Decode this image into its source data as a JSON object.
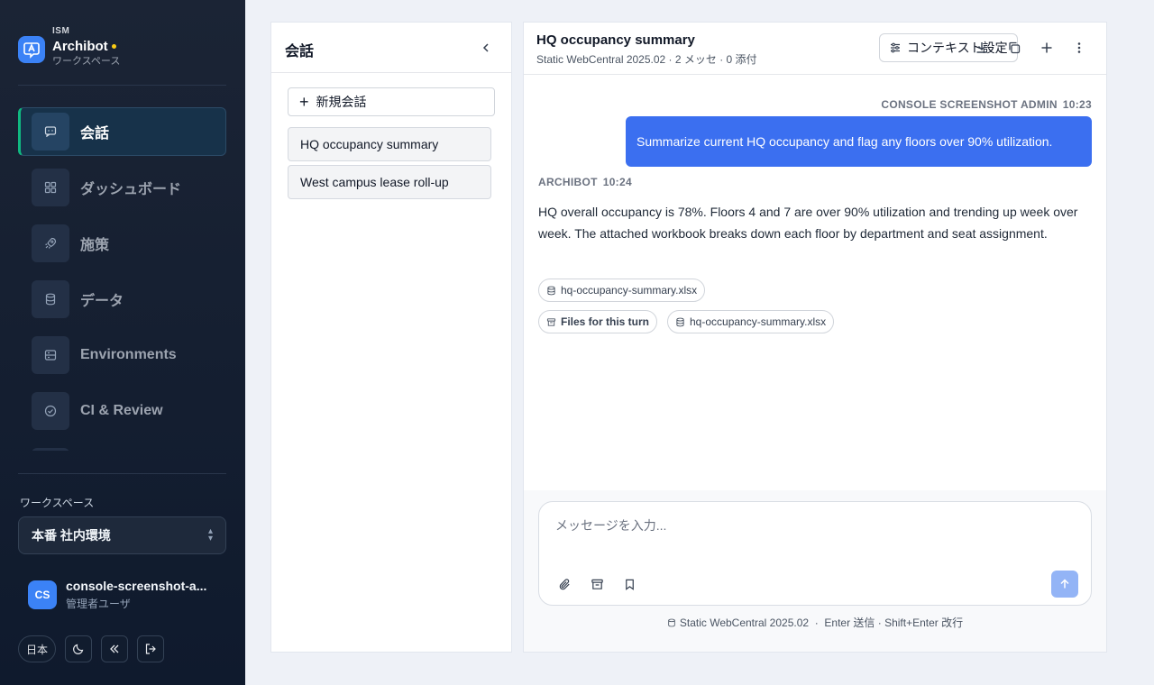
{
  "brand": {
    "tag": "ISM",
    "name": "Archibot",
    "subtitle": "ワークスペース"
  },
  "nav": {
    "items": [
      {
        "label": "会話",
        "icon": "chat-icon",
        "active": true
      },
      {
        "label": "ダッシュボード",
        "icon": "grid-icon",
        "active": false
      },
      {
        "label": "施策",
        "icon": "rocket-icon",
        "active": false
      },
      {
        "label": "データ",
        "icon": "database-icon",
        "active": false
      },
      {
        "label": "Environments",
        "icon": "server-icon",
        "active": false
      },
      {
        "label": "CI & Review",
        "icon": "check-circle-icon",
        "active": false
      }
    ]
  },
  "workspace": {
    "label": "ワークスペース",
    "value": "本番 社内環境"
  },
  "user": {
    "initials": "CS",
    "name": "console-screenshot-a...",
    "role": "管理者ユーザ"
  },
  "bottom": {
    "lang": "日本"
  },
  "threads": {
    "title": "会話",
    "new_label": "新規会話",
    "items": [
      "HQ occupancy summary",
      "West campus lease roll-up"
    ]
  },
  "chat": {
    "title": "HQ occupancy summary",
    "subtitle": "Static WebCentral 2025.02 · 2 メッセ · 0 添付",
    "context_button": "コンテキスト設定",
    "user_meta": {
      "name": "CONSOLE SCREENSHOT ADMIN",
      "time": "10:23"
    },
    "user_message": "Summarize current HQ occupancy and flag any floors over 90% utilization.",
    "bot_meta": {
      "name": "ARCHIBOT",
      "time": "10:24"
    },
    "bot_message": "HQ overall occupancy is 78%. Floors 4 and 7 are over 90% utilization and trending up week over week. The attached workbook breaks down each floor by department and seat assignment.",
    "attachment": "hq-occupancy-summary.xlsx",
    "files_label": "Files for this turn",
    "files_attachment": "hq-occupancy-summary.xlsx"
  },
  "composer": {
    "placeholder": "メッセージを入力...",
    "footer_source": "Static WebCentral 2025.02",
    "footer_hint": "Enter 送信 · Shift+Enter 改行"
  },
  "colors": {
    "accent": "#3b6ff0",
    "sidebar": "#16202f",
    "active_border": "#10b981"
  }
}
